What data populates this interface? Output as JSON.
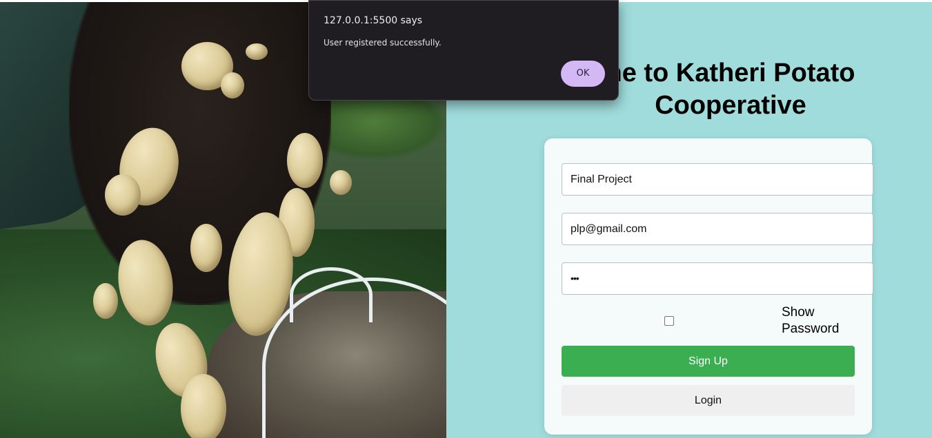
{
  "dialog": {
    "title": "127.0.0.1:5500 says",
    "message": "User registered successfully.",
    "ok_label": "OK"
  },
  "page": {
    "title": "Welcome to Katheri Potato Cooperative",
    "title_visible": "ne to Katheri Potato\nCooperative"
  },
  "form": {
    "name_value": "Final Project",
    "email_value": "plp@gmail.com",
    "password_value": "•••",
    "show_password_label": "Show Password",
    "show_password_checked": false,
    "signup_label": "Sign Up",
    "login_label": "Login"
  },
  "colors": {
    "panel_bg": "#a0dcdc",
    "signup_bg": "#3cae52",
    "dialog_ok_bg": "#d4b8f6"
  },
  "icons": {
    "hero": "potato-harvest-photo"
  }
}
